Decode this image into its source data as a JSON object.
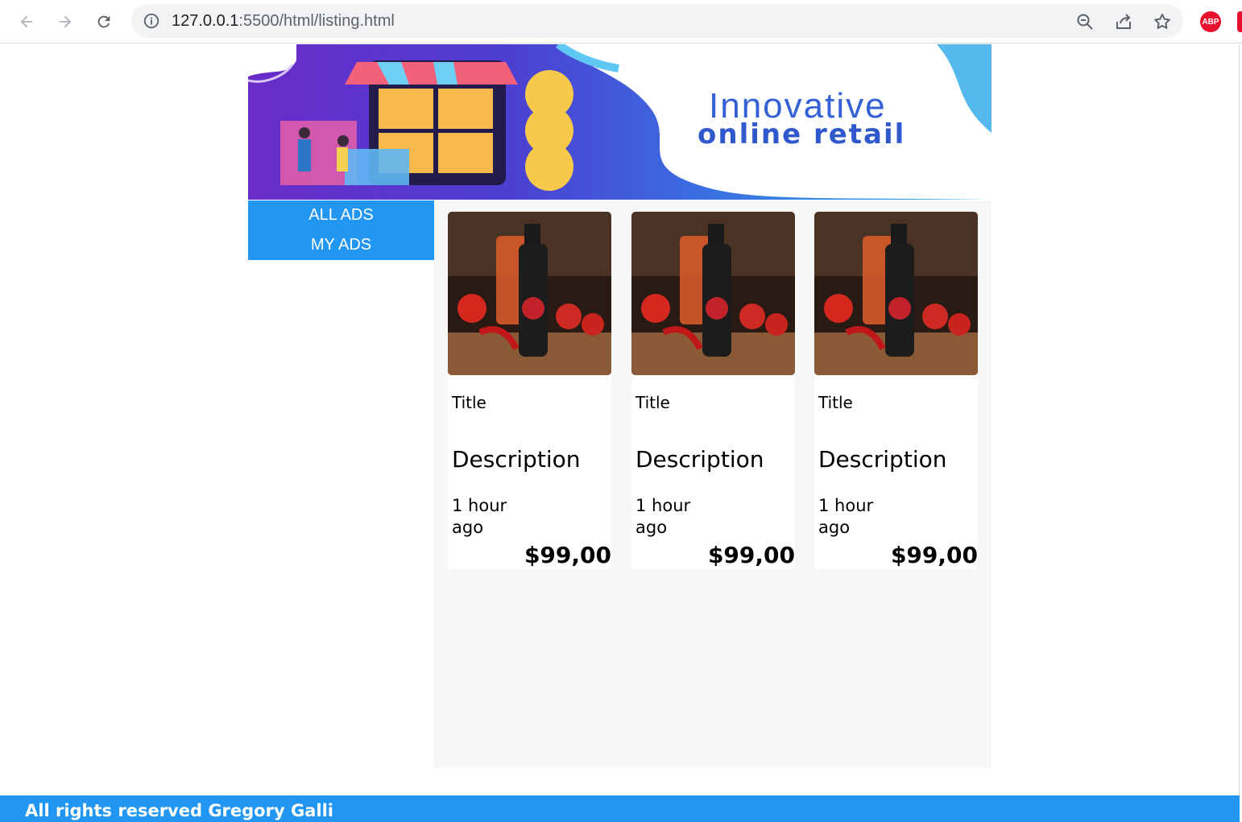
{
  "browser": {
    "url_host": "127.0.0.1",
    "url_rest": ":5500/html/listing.html",
    "abp_label": "ABP"
  },
  "banner": {
    "line1": "Innovative",
    "line2": "online retail"
  },
  "sidebar": {
    "items": [
      {
        "label": "ALL ADS"
      },
      {
        "label": "MY ADS"
      }
    ]
  },
  "listings": [
    {
      "title": "Title",
      "description": "Description",
      "time": "1 hour ago",
      "price": "$99,00"
    },
    {
      "title": "Title",
      "description": "Description",
      "time": "1 hour ago",
      "price": "$99,00"
    },
    {
      "title": "Title",
      "description": "Description",
      "time": "1 hour ago",
      "price": "$99,00"
    }
  ],
  "footer": {
    "text": "All rights reserved Gregory Galli"
  },
  "colors": {
    "accent": "#2196f3",
    "content_bg": "#f7f7f7",
    "abp_red": "#e8102f"
  }
}
